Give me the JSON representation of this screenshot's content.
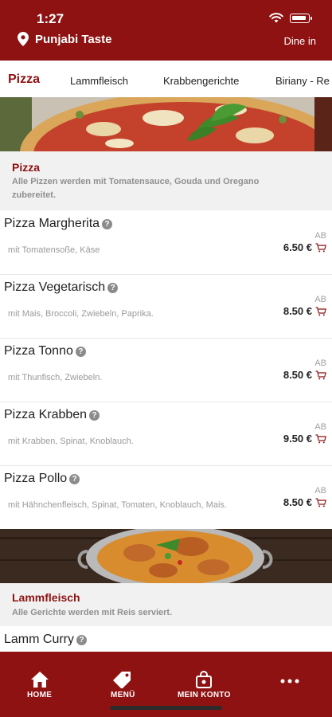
{
  "status_bar": {
    "time": "1:27"
  },
  "header": {
    "restaurant": "Punjabi Taste",
    "mode": "Dine in"
  },
  "tabs": [
    {
      "label": "Pizza",
      "active": true
    },
    {
      "label": "Lammfleisch"
    },
    {
      "label": "Krabbengerichte"
    },
    {
      "label": "Biriany - Re"
    }
  ],
  "categories": [
    {
      "title": "Pizza",
      "description": "Alle Pizzen werden mit Tomatensauce, Gouda und Oregano zubereitet."
    },
    {
      "title": "Lammfleisch",
      "description": "Alle Gerichte werden mit Reis serviert."
    }
  ],
  "items": [
    {
      "name": "Pizza Margherita",
      "desc": "mit Tomatensoße, Käse",
      "from": "AB",
      "price": "6.50 €"
    },
    {
      "name": "Pizza Vegetarisch",
      "desc": "mit Mais, Broccoli, Zwiebeln, Paprika.",
      "from": "AB",
      "price": "8.50 €"
    },
    {
      "name": "Pizza Tonno",
      "desc": "mit Thunfisch, Zwiebeln.",
      "from": "AB",
      "price": "8.50 €"
    },
    {
      "name": "Pizza Krabben",
      "desc": "mit Krabben, Spinat, Knoblauch.",
      "from": "AB",
      "price": "9.50 €"
    },
    {
      "name": "Pizza Pollo",
      "desc": "mit Hähnchenfleisch, Spinat, Tomaten, Knoblauch, Mais.",
      "from": "AB",
      "price": "8.50 €"
    },
    {
      "name": "Lamm Curry"
    }
  ],
  "nav": [
    {
      "label": "HOME",
      "icon": "home-icon"
    },
    {
      "label": "MENÜ",
      "icon": "tag-icon"
    },
    {
      "label": "MEIN KONTO",
      "icon": "bag-icon"
    },
    {
      "label": "",
      "icon": "more-icon"
    }
  ],
  "colors": {
    "brand": "#8e1212",
    "background": "#ffffff",
    "category_bg": "#f1f1f1"
  }
}
